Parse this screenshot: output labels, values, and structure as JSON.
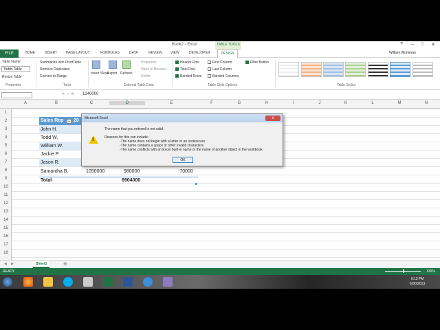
{
  "window": {
    "title": "Book2 - Excel",
    "context_tab": "TABLE TOOLS",
    "user": "William Workman"
  },
  "tabs": [
    "FILE",
    "HOME",
    "INSERT",
    "PAGE LAYOUT",
    "FORMULAS",
    "DATA",
    "REVIEW",
    "VIEW",
    "DEVELOPER",
    "DESIGN"
  ],
  "ribbon": {
    "table_name_label": "Table Name:",
    "table_name_value": "Todds Table",
    "resize_table": "Resize Table",
    "properties_group": "Properties",
    "summarize": "Summarize with PivotTable",
    "remove_duplicates": "Remove Duplicates",
    "convert_to_range": "Convert to Range",
    "tools_group": "Tools",
    "insert_slicer": "Insert Slicer",
    "export": "Export",
    "refresh": "Refresh",
    "properties": "Properties",
    "open_in_browser": "Open in Browser",
    "unlink": "Unlink",
    "ext_group": "External Table Data",
    "header_row": "Header Row",
    "total_row": "Total Row",
    "banded_rows": "Banded Rows",
    "first_column": "First Column",
    "last_column": "Last Column",
    "banded_columns": "Banded Columns",
    "filter_button": "Filter Button",
    "style_options_group": "Table Style Options",
    "styles_group": "Table Styles"
  },
  "formula_bar": {
    "name_box": "",
    "fx": "fx",
    "value": "1240000"
  },
  "columns": [
    "A",
    "B",
    "C",
    "D",
    "E",
    "F",
    "G",
    "H",
    "I",
    "J",
    "K",
    "L",
    "M",
    "N"
  ],
  "rows": [
    "1",
    "2",
    "3",
    "4",
    "5",
    "6",
    "7",
    "8",
    "9",
    "10",
    "11",
    "12",
    "13",
    "14",
    "15",
    "16",
    "17",
    "18"
  ],
  "table": {
    "header": "Sales Rep",
    "header_col2": "20",
    "reps": [
      "John H.",
      "Todd W.",
      "William W.",
      "Jackie P.",
      "Jason R.",
      "Samantha B."
    ],
    "row8": {
      "c": "1050000",
      "d": "980000",
      "e": "-70000"
    },
    "total_label": "Total",
    "total_value": "6904000"
  },
  "dialog": {
    "title": "Microsoft Excel",
    "close": "x",
    "line1": "The name that you entered is not valid.",
    "line2": "Reasons for this can include:",
    "reason1": "-The name does not begin with a letter or an underscore",
    "reason2": "-The name contains a space or other invalid characters",
    "reason3": "-The name conflicts with an Excel built-in name or the name of another object in the workbook",
    "ok": "OK"
  },
  "sheet_tab": "Sheet1",
  "status": {
    "ready": "READY",
    "zoom": "130%"
  },
  "clock": {
    "time": "6:13 PM",
    "date": "6/30/2013"
  },
  "colors": {
    "accent": "#217346",
    "table_header": "#5b9bd5",
    "band": "#ddebf7"
  }
}
